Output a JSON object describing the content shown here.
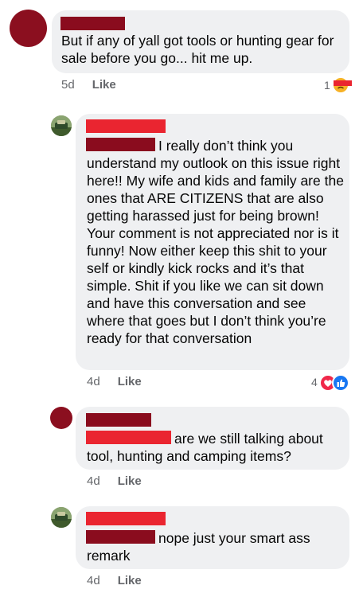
{
  "comments": [
    {
      "text": "But if any of yall got tools or hunting gear for sale before you go... hit me up.",
      "time": "5d",
      "like_label": "Like",
      "reaction_count": "1",
      "reactions": [
        "sad-face-icon"
      ]
    },
    {
      "text": "I really don’t think you understand my outlook on this issue right here!! My wife and kids and family are the ones that ARE CITIZENS that are also getting harassed just for being brown! Your comment is not appreciated nor is it funny! Now either keep this shit to your self or kindly kick rocks and it’s that simple. Shit if you like we can sit down and have this conversation and see where that goes but I don’t think you’re ready for that conversation",
      "time": "4d",
      "like_label": "Like",
      "reaction_count": "4",
      "reactions": [
        "love-heart-icon",
        "thumbs-up-icon"
      ]
    },
    {
      "text": "are we still talking about tool, hunting and camping items?",
      "time": "4d",
      "like_label": "Like"
    },
    {
      "text": "nope just your smart ass remark",
      "time": "4d",
      "like_label": "Like"
    }
  ],
  "colors": {
    "bubble": "#eff0f2",
    "redaction_dark": "#8a0c1e",
    "redaction_bright": "#ea2530",
    "meta_text": "#65676b",
    "love": "#f0284a",
    "like": "#1877f2",
    "sad": "#f7b125"
  }
}
